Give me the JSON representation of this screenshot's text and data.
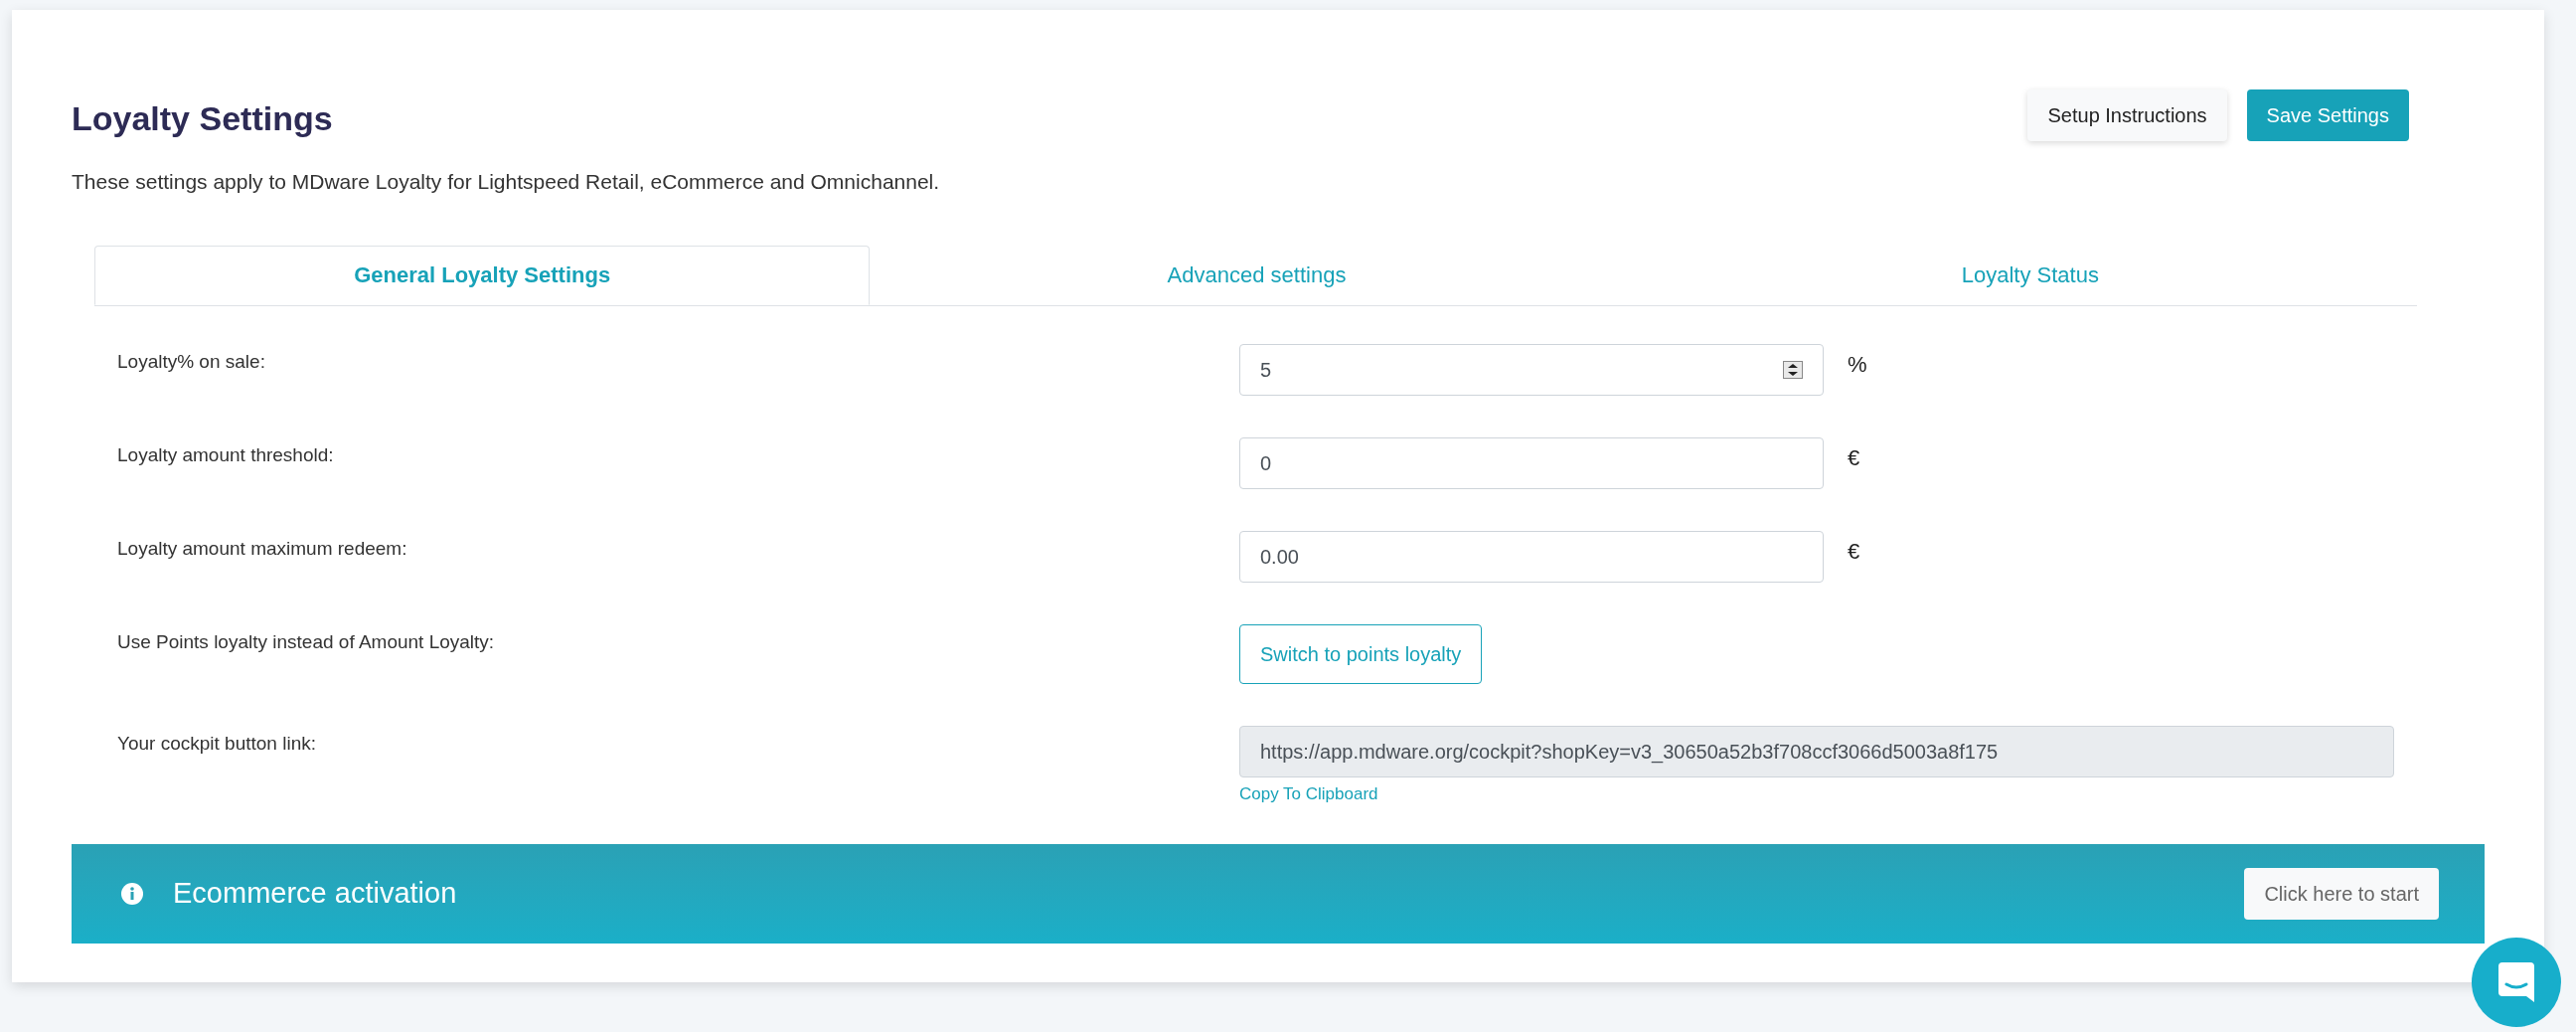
{
  "header": {
    "title": "Loyalty Settings",
    "description": "These settings apply to MDware Loyalty for Lightspeed Retail, eCommerce and Omnichannel.",
    "buttons": [
      {
        "label": "Setup Instructions",
        "kind": "secondary"
      },
      {
        "label": "Save Settings",
        "kind": "primary"
      }
    ]
  },
  "tabs": [
    {
      "label": "General Loyalty Settings",
      "selected": true
    },
    {
      "label": "Advanced settings",
      "selected": false
    },
    {
      "label": "Loyalty Status",
      "selected": false
    }
  ],
  "settings": [
    {
      "label": "Loyalty% on sale:",
      "kind": "number",
      "value": "5",
      "unit": "%"
    },
    {
      "label": "Loyalty amount threshold:",
      "kind": "text",
      "value": "0",
      "unit": "€"
    },
    {
      "label": "Loyalty amount maximum redeem:",
      "kind": "text",
      "value": "0.00",
      "unit": "€"
    },
    {
      "label": "Use Points loyalty instead of Amount Loyalty:",
      "kind": "button",
      "value": "Switch to points loyalty"
    },
    {
      "label": "Your cockpit button link:",
      "kind": "readonly",
      "value": "https://app.mdware.org/cockpit?shopKey=v3_30650a52b3f708ccf3066d5003a8f175",
      "link": "Copy To Clipboard"
    }
  ],
  "banner": {
    "title": "Ecommerce activation",
    "button": "Click here to start"
  }
}
